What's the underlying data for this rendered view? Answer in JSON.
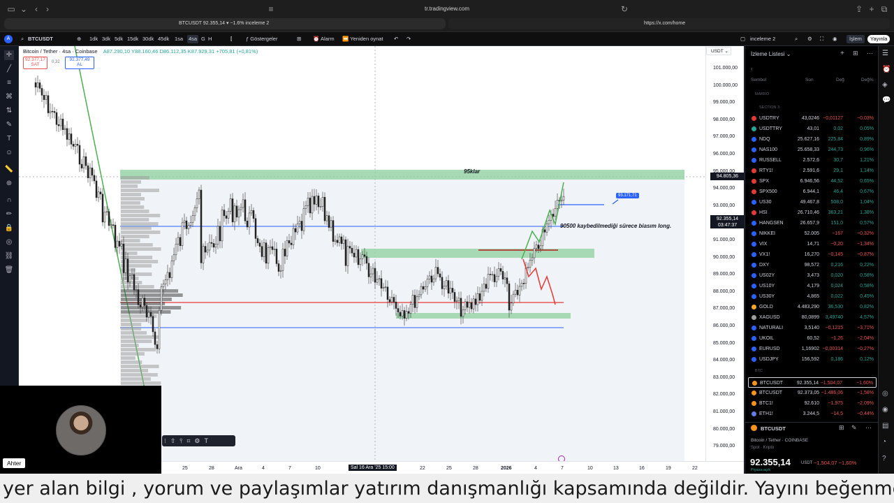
{
  "browser": {
    "url": "tr.tradingview.com",
    "tab_left": "BTCUSDT 92.355,14 ▾ −1.6% inceleme 2",
    "tab_right": "https://x.com/home"
  },
  "toolbar": {
    "symbol": "BTCUSDT",
    "intervals": [
      "1dk",
      "3dk",
      "5dk",
      "15dk",
      "30dk",
      "45dk",
      "1sa",
      "4sa",
      "G",
      "H"
    ],
    "selected_interval": "4sa",
    "indicators": "Göstergeler",
    "alarm": "Alarm",
    "replay": "Yeniden oynat",
    "layout_name": "inceleme 2",
    "layout_sub": "Kaydet",
    "trade": "İşlem",
    "publish": "Yayınla"
  },
  "legend": {
    "title": "Bitcoin / Tether · 4sa · Coinbase",
    "ohlc": "A87.290,10 Y88.160,46 D86.112,35 K87.929,31 +705,81 (+0,81%)",
    "sell_price": "92.377,17",
    "sell_label": "SAT",
    "spread": "0,32",
    "buy_price": "92.377,49",
    "buy_label": "AL"
  },
  "currency": "USDT",
  "price_axis": [
    "101.000,00",
    "100.000,00",
    "99.000,00",
    "98.000,00",
    "97.000,00",
    "96.000,00",
    "95.000,00",
    "94.000,00",
    "93.000,00",
    "92.000,00",
    "91.000,00",
    "90.000,00",
    "89.000,00",
    "88.000,00",
    "87.000,00",
    "86.000,00",
    "85.000,00",
    "84.000,00",
    "83.000,00",
    "82.000,00",
    "81.000,00",
    "80.000,00",
    "79.000,00"
  ],
  "crosshair_price": "94.805,36",
  "last_price_label": "92.355,14",
  "last_price_timer": "03:47:37",
  "time_axis": [
    "25",
    "28",
    "Ara",
    "4",
    "7",
    "10",
    "13",
    "Sal 16 Ara '25  15:00",
    "22",
    "25",
    "28",
    "2026",
    "4",
    "7",
    "10",
    "13",
    "16",
    "19",
    "22"
  ],
  "annotations": {
    "resistance": "95klar",
    "note": "90500 kaybedilmediği sürece biasım long.",
    "blue_tag": "93.171,71"
  },
  "watchlist": {
    "title": "İzleme Listesi",
    "headers": {
      "symbol": "Sembol",
      "last": "Son",
      "chg": "Değ",
      "pct": "Değ%"
    },
    "section_macro": "MAKRO",
    "section_3": "SECTION 3",
    "section_btc": "BTC",
    "rows": [
      {
        "sym": "USDTRY",
        "last": "43,0246",
        "chg": "−0,01127",
        "pct": "−0,03%",
        "dir": "dn",
        "color": "#e53935"
      },
      {
        "sym": "USDTTRY",
        "last": "43,01",
        "chg": "0,02",
        "pct": "0,05%",
        "dir": "up",
        "color": "#26a69a"
      },
      {
        "sym": "NDQ",
        "last": "25.627,16",
        "chg": "225,84",
        "pct": "0,89%",
        "dir": "up",
        "color": "#2962ff"
      },
      {
        "sym": "NAS100",
        "last": "25.658,33",
        "chg": "244,73",
        "pct": "0,96%",
        "dir": "up",
        "color": "#2962ff"
      },
      {
        "sym": "RUSSELL",
        "last": "2.572,6",
        "chg": "30,7",
        "pct": "1,21%",
        "dir": "up",
        "color": "#2962ff"
      },
      {
        "sym": "RTY1!",
        "last": "2.591,6",
        "chg": "29,1",
        "pct": "1,14%",
        "dir": "up",
        "color": "#e53935"
      },
      {
        "sym": "SPX",
        "last": "6.946,56",
        "chg": "44,52",
        "pct": "0,65%",
        "dir": "up",
        "color": "#e53935"
      },
      {
        "sym": "SPX500",
        "last": "6.944,1",
        "chg": "46,4",
        "pct": "0,67%",
        "dir": "up",
        "color": "#e53935"
      },
      {
        "sym": "US30",
        "last": "49.467,8",
        "chg": "508,0",
        "pct": "1,04%",
        "dir": "up",
        "color": "#2962ff"
      },
      {
        "sym": "HSI",
        "last": "26.710,46",
        "chg": "363,21",
        "pct": "1,38%",
        "dir": "up",
        "color": "#e53935"
      },
      {
        "sym": "HANGSEN",
        "last": "26.657,9",
        "chg": "151,0",
        "pct": "0,57%",
        "dir": "up",
        "color": "#2962ff"
      },
      {
        "sym": "NIKKEI",
        "last": "52.005",
        "chg": "−167",
        "pct": "−0,32%",
        "dir": "dn",
        "color": "#2962ff"
      },
      {
        "sym": "VIX",
        "last": "14,71",
        "chg": "−0,20",
        "pct": "−1,34%",
        "dir": "dn",
        "color": "#2962ff"
      },
      {
        "sym": "VX1!",
        "last": "16,270",
        "chg": "−0,145",
        "pct": "−0,87%",
        "dir": "dn",
        "color": "#2962ff"
      },
      {
        "sym": "DXY",
        "last": "98,572",
        "chg": "0,216",
        "pct": "0,22%",
        "dir": "up",
        "color": "#2962ff"
      },
      {
        "sym": "US02Y",
        "last": "3,473",
        "chg": "0,020",
        "pct": "0,58%",
        "dir": "up",
        "color": "#2962ff"
      },
      {
        "sym": "US10Y",
        "last": "4,179",
        "chg": "0,024",
        "pct": "0,58%",
        "dir": "up",
        "color": "#2962ff"
      },
      {
        "sym": "US30Y",
        "last": "4,865",
        "chg": "0,022",
        "pct": "0,45%",
        "dir": "up",
        "color": "#2962ff"
      },
      {
        "sym": "GOLD",
        "last": "4.483,290",
        "chg": "36,530",
        "pct": "0,82%",
        "dir": "up",
        "color": "#f9a825"
      },
      {
        "sym": "XAGUSD",
        "last": "80,0899",
        "chg": "3,49740",
        "pct": "4,57%",
        "dir": "up",
        "color": "#9e9e9e"
      },
      {
        "sym": "NATURALI",
        "last": "3,5140",
        "chg": "−0,1215",
        "pct": "−3,71%",
        "dir": "dn",
        "color": "#2962ff"
      },
      {
        "sym": "UKOIL",
        "last": "60,52",
        "chg": "−1,26",
        "pct": "−2,04%",
        "dir": "dn",
        "color": "#2962ff"
      },
      {
        "sym": "EURUSD",
        "last": "1,16902",
        "chg": "−0,00314",
        "pct": "−0,27%",
        "dir": "dn",
        "color": "#2962ff"
      },
      {
        "sym": "USDJPY",
        "last": "156,592",
        "chg": "0,186",
        "pct": "0,12%",
        "dir": "up",
        "color": "#2962ff"
      }
    ],
    "btc_rows": [
      {
        "sym": "BTCUSDT",
        "last": "92.355,14",
        "chg": "−1.504,07",
        "pct": "−1,60%",
        "dir": "dn",
        "color": "#f7931a"
      },
      {
        "sym": "BTCUSDT",
        "last": "92.373,05",
        "chg": "−1.486,06",
        "pct": "−1,58%",
        "dir": "dn",
        "color": "#f7931a"
      },
      {
        "sym": "BTC1!",
        "last": "92.610",
        "chg": "−1.975",
        "pct": "−2,09%",
        "dir": "dn",
        "color": "#f7931a"
      },
      {
        "sym": "ETH1!",
        "last": "3.244,5",
        "chg": "−14,5",
        "pct": "−0,44%",
        "dir": "dn",
        "color": "#627eea"
      }
    ]
  },
  "details": {
    "symbol": "BTCUSDT",
    "name": "Bitcoin / Tether · COINBASE",
    "type": "Spot · Kripto",
    "price": "92.355,14",
    "currency": "USDT",
    "change": "−1.504,07",
    "pct": "−1,60%",
    "status": "Piyasa açık"
  },
  "webcam_label": "Ahter",
  "ticker_text": "yer alan bilgi , yorum ve paylaşımlar yatırım danışmanlığı kapsamında değildir. Yayını beğenmeyi ve kanalı"
}
